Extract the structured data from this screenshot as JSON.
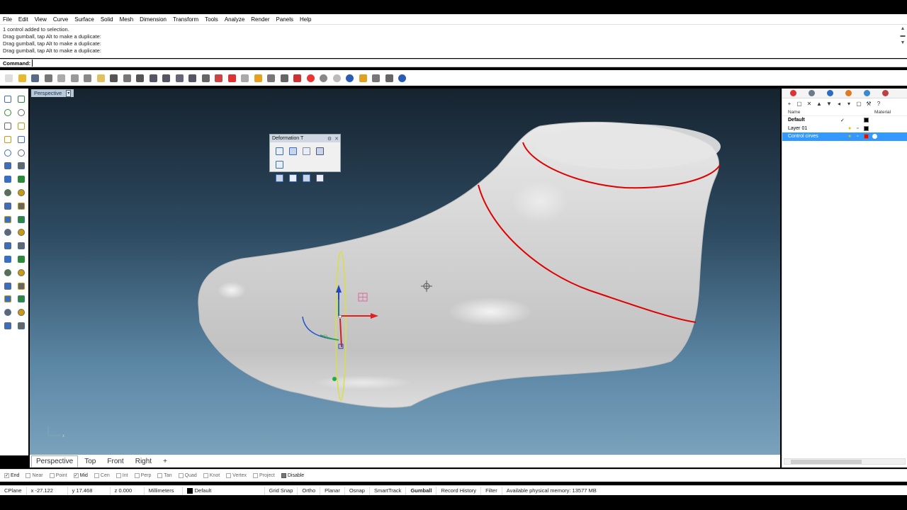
{
  "menu": [
    "File",
    "Edit",
    "View",
    "Curve",
    "Surface",
    "Solid",
    "Mesh",
    "Dimension",
    "Transform",
    "Tools",
    "Analyze",
    "Render",
    "Panels",
    "Help"
  ],
  "history": [
    "1 control added to selection.",
    "Drag gumball, tap Alt to make a duplicate:",
    "Drag gumball, tap Alt to make a duplicate:",
    "Drag gumball, tap Alt to make a duplicate:"
  ],
  "command": {
    "label": "Command:",
    "value": ""
  },
  "toolbar_icons": [
    "new-file-icon",
    "open-icon",
    "save-icon",
    "print-icon",
    "import-icon",
    "cut-icon",
    "copy-icon",
    "paste-icon",
    "undo-icon",
    "pan-icon",
    "move-view-icon",
    "zoom-icon",
    "zoom-window-icon",
    "zoom-extents-icon",
    "zoom-selected-icon",
    "rotate-view-icon",
    "four-views-icon",
    "car-icon",
    "grid-icon",
    "snap-icon",
    "select-points-icon",
    "lock-icon",
    "shade-icon",
    "color-wheel-icon",
    "sphere-gray-icon",
    "sphere-white-icon",
    "sphere-blue-icon",
    "gear-light-icon",
    "settings-icon",
    "options-icon",
    "help-icon"
  ],
  "toolbar_colors": [
    "#ddd",
    "#e8b830",
    "#5a6b8a",
    "#777",
    "#aaa",
    "#999",
    "#888",
    "#e0c060",
    "#555",
    "#777",
    "#555",
    "#556",
    "#556",
    "#667",
    "#556",
    "#666",
    "#c44",
    "#d33",
    "#aaa",
    "#e8a020",
    "#777",
    "#666",
    "#c33",
    "#e33",
    "#888",
    "#bbb",
    "#2a5cb5",
    "#e0a020",
    "#777",
    "#666",
    "#2a5cb5"
  ],
  "sidebar_icons": [
    [
      "select-icon",
      "point-icon"
    ],
    [
      "polyline-icon",
      "curve-icon"
    ],
    [
      "circle-icon",
      "arc-icon"
    ],
    [
      "rectangle-icon",
      "polygon-icon"
    ],
    [
      "ellipse-icon",
      "freeform-icon"
    ],
    [
      "surface-icon",
      "extrude-icon"
    ],
    [
      "box-icon",
      "sphere-icon"
    ],
    [
      "cylinder-icon",
      "pipe-icon"
    ],
    [
      "boolean-icon",
      "fillet-icon"
    ],
    [
      "offset-icon",
      "trim-icon"
    ],
    [
      "join-icon",
      "explode-icon"
    ],
    [
      "group-icon",
      "ungroup-icon"
    ],
    [
      "text-icon",
      "dimension-icon"
    ],
    [
      "array-icon",
      "mirror-icon"
    ],
    [
      "mesh-icon",
      "mesh-tools-icon"
    ],
    [
      "grid-icon",
      "display-icon"
    ],
    [
      "analyze-icon",
      "check-icon"
    ],
    [
      "render-icon",
      "light-icon"
    ]
  ],
  "viewport": {
    "title": "Perspective"
  },
  "deformation": {
    "title": "Deformation T",
    "icons": [
      "cage-edit-icon",
      "flow-icon",
      "twist-icon",
      "stretch-icon",
      "taper-icon",
      "bend-icon",
      "flow-surface-icon",
      "smooth-icon",
      "splop-icon"
    ]
  },
  "panel": {
    "tab_colors": [
      "#d33",
      "#6a7a8a",
      "#2a6bc5",
      "#e07a20",
      "#3a8ad0",
      "#c04040"
    ],
    "tools": [
      "+",
      "▢",
      "✕",
      "▲",
      "▼",
      "◂",
      "▾",
      "▢",
      "⚒",
      "?"
    ],
    "col_name": "Name",
    "col_material": "Material",
    "layers": [
      {
        "name": "Default",
        "check": "✓",
        "bulb": "",
        "lock": "",
        "color": "#000000",
        "material": "",
        "bold": true,
        "selected": false
      },
      {
        "name": "Layer 01",
        "check": "",
        "bulb": "💡",
        "lock": "🔓",
        "color": "#000000",
        "material": "",
        "bold": false,
        "selected": false
      },
      {
        "name": "Control cirves",
        "check": "",
        "bulb": "💡",
        "lock": "🔓",
        "color": "#ff0000",
        "material": "#ffffff",
        "bold": false,
        "selected": true
      }
    ]
  },
  "view_tabs": [
    "Perspective",
    "Top",
    "Front",
    "Right",
    "+"
  ],
  "snaps": [
    {
      "label": "End",
      "on": true
    },
    {
      "label": "Near",
      "on": false
    },
    {
      "label": "Point",
      "on": false
    },
    {
      "label": "Mid",
      "on": true
    },
    {
      "label": "Cen",
      "on": false
    },
    {
      "label": "Int",
      "on": false
    },
    {
      "label": "Perp",
      "on": false
    },
    {
      "label": "Tan",
      "on": false
    },
    {
      "label": "Quad",
      "on": false
    },
    {
      "label": "Knot",
      "on": false
    },
    {
      "label": "Vertex",
      "on": false
    },
    {
      "label": "Project",
      "on": false
    },
    {
      "label": "Disable",
      "on": true
    }
  ],
  "status": {
    "cplane": "CPlane",
    "x": "x -27.122",
    "y": "y 17.468",
    "z": "z 0.000",
    "units": "Millimeters",
    "layer": "Default",
    "grid_snap": "Grid Snap",
    "ortho": "Ortho",
    "planar": "Planar",
    "osnap": "Osnap",
    "smarttrack": "SmartTrack",
    "gumball": "Gumball",
    "record_history": "Record History",
    "filter": "Filter",
    "memory": "Available physical memory: 13577 MB"
  },
  "colors": {
    "viewport_top": "#16232f",
    "viewport_bottom": "#7aa2bd",
    "selection": "#3399ff",
    "curve": "#e00000"
  }
}
